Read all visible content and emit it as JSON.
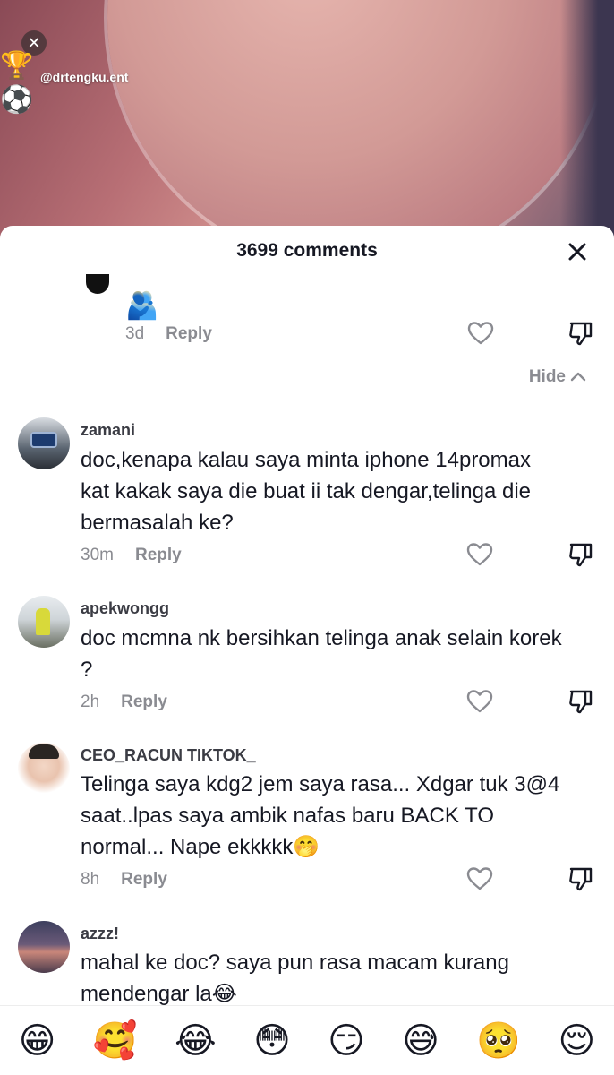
{
  "video": {
    "handle": "@drtengku.ent",
    "close_glyph": "✕",
    "trophy_glyph": "🏆",
    "soccer_glyph": "⚽"
  },
  "sheet": {
    "title": "3699 comments",
    "hide_label": "Hide"
  },
  "reply_block": {
    "emoji": "🫂",
    "time": "3d",
    "reply_label": "Reply"
  },
  "comments": [
    {
      "username": "zamani",
      "text": "doc,kenapa kalau saya minta iphone 14promax kat kakak saya die buat ii tak dengar,telinga die bermasalah ke?",
      "time": "30m",
      "reply_label": "Reply"
    },
    {
      "username": "apekwongg",
      "text": "doc mcmna nk bersihkan telinga anak selain korek ?",
      "time": "2h",
      "reply_label": "Reply"
    },
    {
      "username": "CEO_RACUN TIKTOK_",
      "text": "Telinga saya kdg2 jem saya rasa... Xdgar tuk 3@4 saat..lpas saya ambik nafas baru BACK TO normal... Nape ekkkkk🤭",
      "time": "8h",
      "reply_label": "Reply"
    },
    {
      "username": "azzz!",
      "text": "mahal ke doc? saya pun rasa macam kurang mendengar la😂",
      "time": "",
      "reply_label": ""
    }
  ],
  "emoji_bar": [
    "😁",
    "🥰",
    "😂",
    "😳",
    "😏",
    "😅",
    "🥺",
    "😌"
  ]
}
